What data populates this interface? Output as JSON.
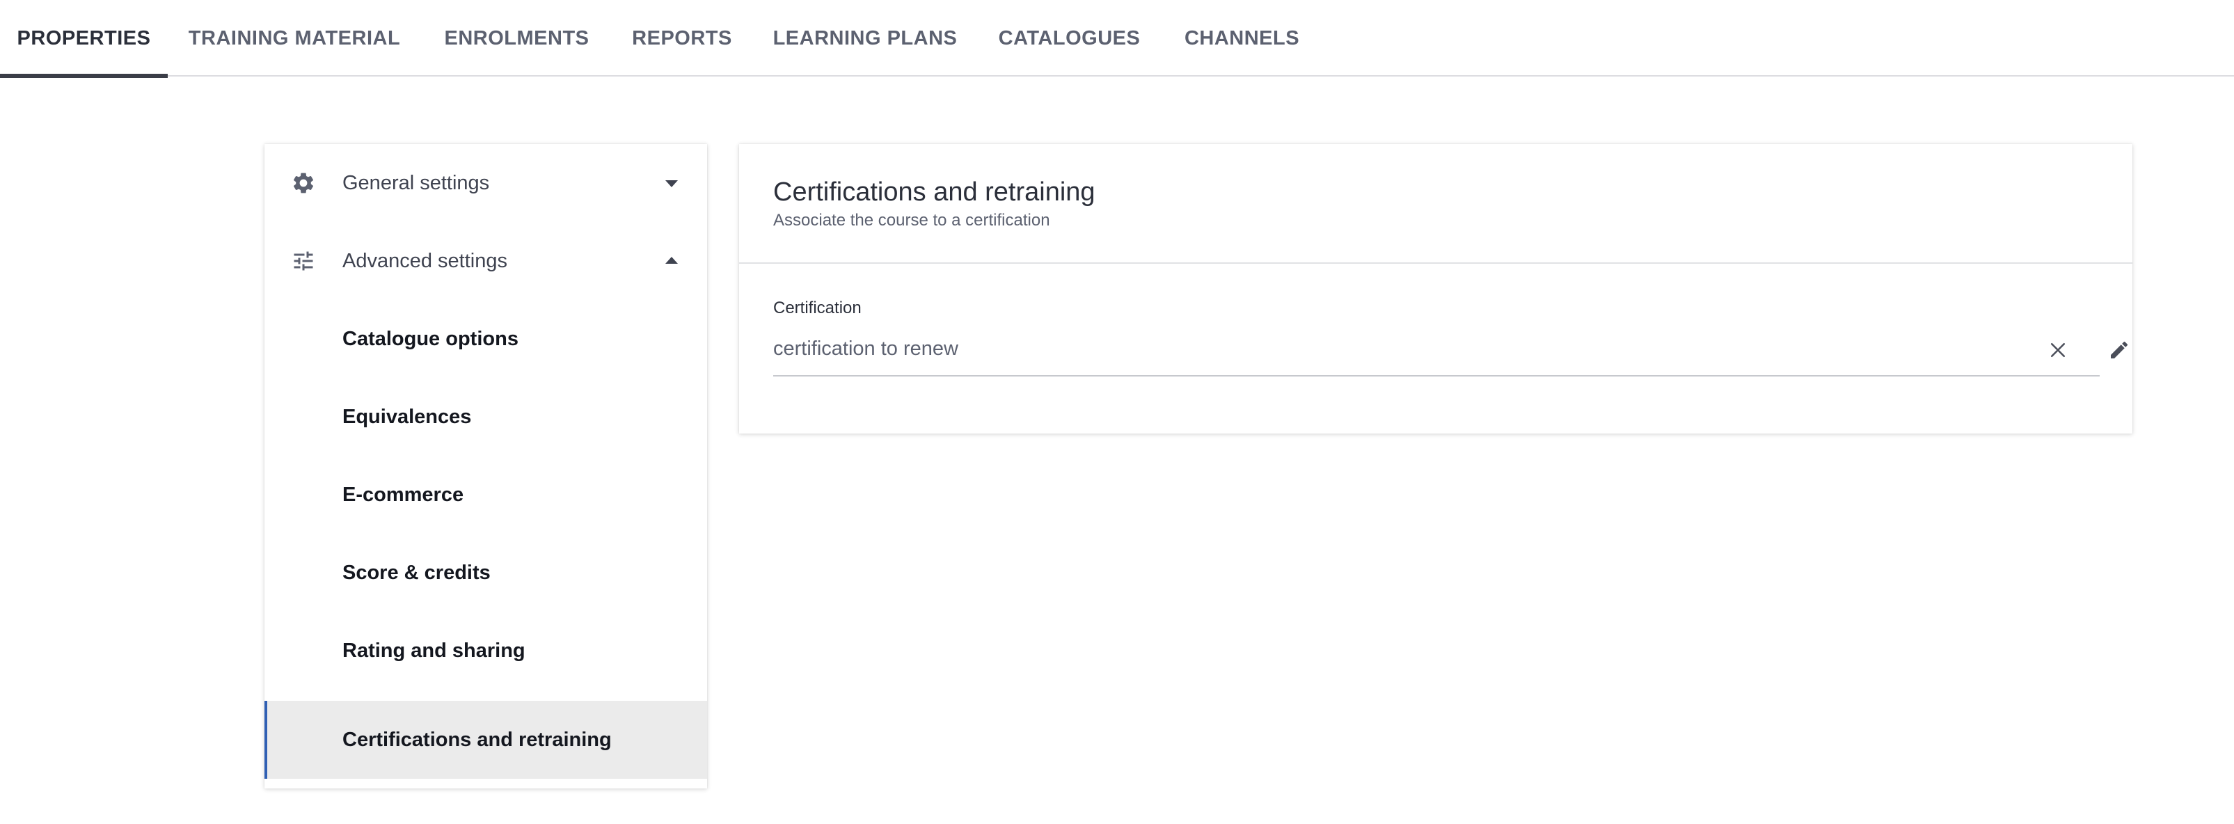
{
  "tabs": [
    {
      "label": "PROPERTIES",
      "active": true
    },
    {
      "label": "TRAINING MATERIAL",
      "active": false
    },
    {
      "label": "ENROLMENTS",
      "active": false
    },
    {
      "label": "REPORTS",
      "active": false
    },
    {
      "label": "LEARNING PLANS",
      "active": false
    },
    {
      "label": "CATALOGUES",
      "active": false
    },
    {
      "label": "CHANNELS",
      "active": false
    }
  ],
  "sidebar": {
    "general": {
      "label": "General settings",
      "icon": "gear-icon",
      "expanded": false
    },
    "advanced": {
      "label": "Advanced settings",
      "icon": "sliders-icon",
      "expanded": true
    },
    "items": [
      {
        "label": "Catalogue options",
        "selected": false
      },
      {
        "label": "Equivalences",
        "selected": false
      },
      {
        "label": "E-commerce",
        "selected": false
      },
      {
        "label": "Score & credits",
        "selected": false
      },
      {
        "label": "Rating and sharing",
        "selected": false
      },
      {
        "label": "Certifications and retraining",
        "selected": true
      }
    ]
  },
  "panel": {
    "title": "Certifications and retraining",
    "subtitle": "Associate the course to a certification",
    "field": {
      "label": "Certification",
      "value": "certification to renew",
      "clear_icon": "close-icon",
      "edit_icon": "pencil-icon"
    }
  },
  "colors": {
    "accent": "#2f5fb3",
    "active_tab_underline": "#3a3d47",
    "selected_row_bg": "#ebebeb"
  }
}
